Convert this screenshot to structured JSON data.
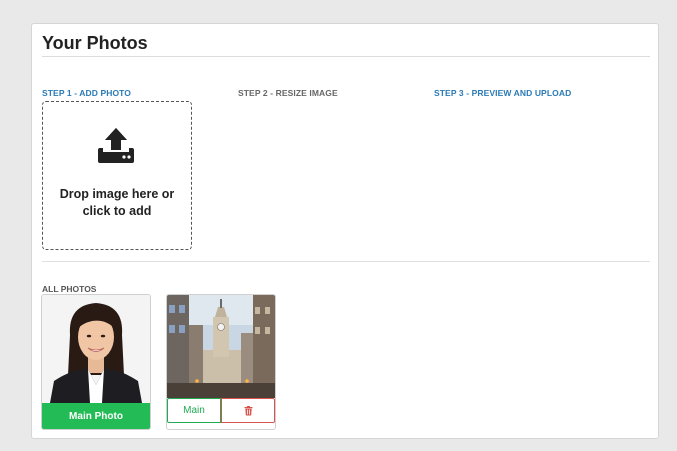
{
  "panel": {
    "title": "Your Photos"
  },
  "steps": [
    {
      "label": "STEP 1 - ADD PHOTO",
      "state": "active"
    },
    {
      "label": "STEP 2 - RESIZE IMAGE",
      "state": "inactive"
    },
    {
      "label": "STEP 3 - PREVIEW AND UPLOAD",
      "state": "active"
    }
  ],
  "dropzone": {
    "icon": "upload-icon",
    "text": "Drop image here or click to add"
  },
  "gallery": {
    "label": "ALL PHOTOS",
    "photos": [
      {
        "subject": "portrait of a woman",
        "action_label": "Main Photo",
        "is_main": true
      },
      {
        "subject": "city hall tower street view",
        "action_label": "Main",
        "delete_icon": "trash-icon",
        "is_main": false
      }
    ]
  },
  "colors": {
    "accent_blue": "#2a7ab5",
    "success_green": "#22bb55",
    "danger_red": "#d9534f"
  }
}
